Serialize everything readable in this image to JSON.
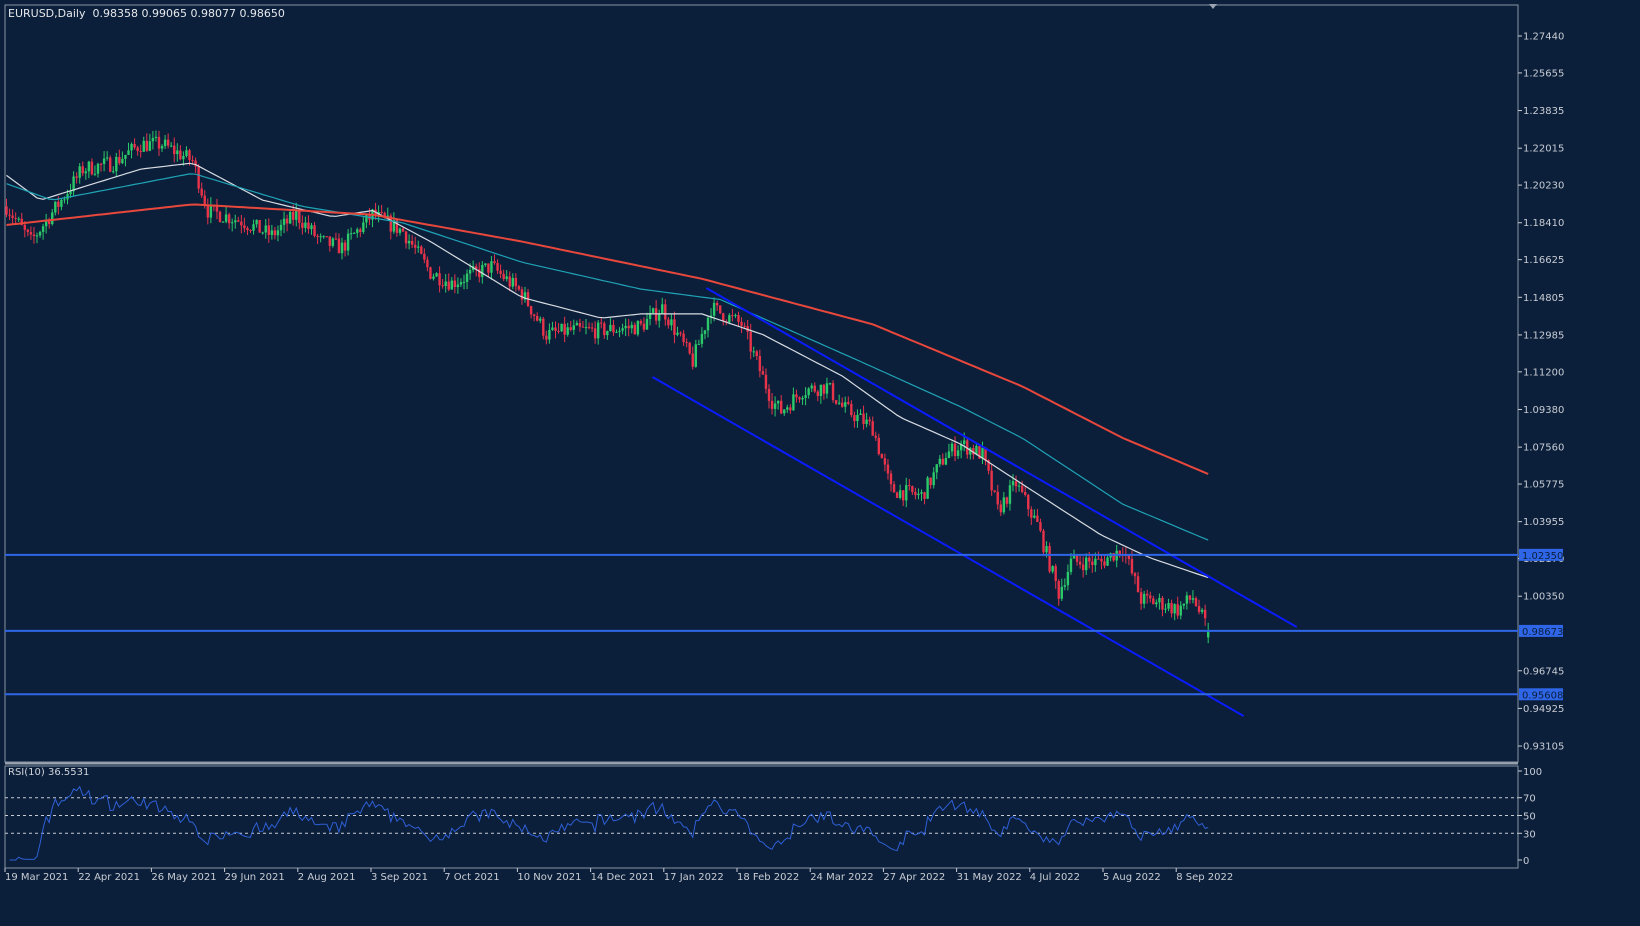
{
  "header": {
    "symbol": "EURUSD,Daily",
    "ohlc": "0.98358 0.99065 0.98077 0.98650"
  },
  "rsi_header": {
    "label": "RSI(10)",
    "value": "36.5531"
  },
  "chart_data": {
    "type": "candlestick",
    "symbol": "EURUSD",
    "timeframe": "Daily",
    "last_bar": {
      "open": 0.98358,
      "high": 0.99065,
      "low": 0.98077,
      "close": 0.9865
    },
    "ylim": [
      0.921,
      1.2885
    ],
    "y_ticks": [
      "1.27440",
      "1.25655",
      "1.23835",
      "1.22015",
      "1.20230",
      "1.18410",
      "1.16625",
      "1.14805",
      "1.12985",
      "1.11200",
      "1.09380",
      "1.07560",
      "1.05775",
      "1.03955",
      "1.02170",
      "1.00350",
      "0.96745",
      "0.94925",
      "0.93105"
    ],
    "x_ticks": [
      "19 Mar 2021",
      "22 Apr 2021",
      "26 May 2021",
      "29 Jun 2021",
      "2 Aug 2021",
      "3 Sep 2021",
      "7 Oct 2021",
      "10 Nov 2021",
      "14 Dec 2021",
      "17 Jan 2022",
      "18 Feb 2022",
      "24 Mar 2022",
      "27 Apr 2022",
      "31 May 2022",
      "4 Jul 2022",
      "5 Aug 2022",
      "8 Sep 2022"
    ],
    "bars_per_tick": 24,
    "bar_count": 395,
    "close_path": [
      [
        0,
        1.192
      ],
      [
        8,
        1.175
      ],
      [
        18,
        1.195
      ],
      [
        25,
        1.21
      ],
      [
        35,
        1.213
      ],
      [
        44,
        1.222
      ],
      [
        51,
        1.222
      ],
      [
        61,
        1.214
      ],
      [
        66,
        1.19
      ],
      [
        77,
        1.185
      ],
      [
        87,
        1.178
      ],
      [
        95,
        1.188
      ],
      [
        103,
        1.175
      ],
      [
        110,
        1.172
      ],
      [
        120,
        1.188
      ],
      [
        130,
        1.18
      ],
      [
        139,
        1.16
      ],
      [
        146,
        1.155
      ],
      [
        159,
        1.163
      ],
      [
        169,
        1.15
      ],
      [
        177,
        1.13
      ],
      [
        185,
        1.132
      ],
      [
        195,
        1.132
      ],
      [
        208,
        1.134
      ],
      [
        215,
        1.143
      ],
      [
        225,
        1.117
      ],
      [
        231,
        1.143
      ],
      [
        241,
        1.135
      ],
      [
        251,
        1.098
      ],
      [
        254,
        1.093
      ],
      [
        261,
        1.103
      ],
      [
        269,
        1.105
      ],
      [
        274,
        1.095
      ],
      [
        284,
        1.085
      ],
      [
        290,
        1.055
      ],
      [
        300,
        1.052
      ],
      [
        308,
        1.072
      ],
      [
        313,
        1.077
      ],
      [
        320,
        1.072
      ],
      [
        325,
        1.045
      ],
      [
        331,
        1.058
      ],
      [
        338,
        1.038
      ],
      [
        345,
        1.005
      ],
      [
        349,
        1.02
      ],
      [
        359,
        1.02
      ],
      [
        366,
        1.027
      ],
      [
        372,
        1.002
      ],
      [
        379,
        1.0
      ],
      [
        384,
        0.997
      ],
      [
        389,
        1.003
      ],
      [
        394,
        0.9865
      ]
    ],
    "moving_averages": [
      {
        "name": "MA50",
        "color": "#d8dce2",
        "points": [
          [
            0,
            1.207
          ],
          [
            11,
            1.195
          ],
          [
            44,
            1.21
          ],
          [
            61,
            1.213
          ],
          [
            84,
            1.195
          ],
          [
            107,
            1.187
          ],
          [
            120,
            1.19
          ],
          [
            139,
            1.175
          ],
          [
            169,
            1.148
          ],
          [
            195,
            1.138
          ],
          [
            208,
            1.14
          ],
          [
            228,
            1.14
          ],
          [
            248,
            1.13
          ],
          [
            274,
            1.11
          ],
          [
            293,
            1.09
          ],
          [
            313,
            1.077
          ],
          [
            339,
            1.052
          ],
          [
            359,
            1.033
          ],
          [
            375,
            1.022
          ],
          [
            395,
            1.012
          ]
        ]
      },
      {
        "name": "MA100",
        "color": "#1fa3b5",
        "points": [
          [
            0,
            1.203
          ],
          [
            15,
            1.195
          ],
          [
            61,
            1.208
          ],
          [
            97,
            1.192
          ],
          [
            130,
            1.184
          ],
          [
            169,
            1.165
          ],
          [
            208,
            1.152
          ],
          [
            234,
            1.147
          ],
          [
            280,
            1.117
          ],
          [
            313,
            1.095
          ],
          [
            333,
            1.08
          ],
          [
            366,
            1.048
          ],
          [
            395,
            1.03
          ]
        ]
      },
      {
        "name": "MA200",
        "color": "#e8473c",
        "points": [
          [
            0,
            1.183
          ],
          [
            61,
            1.193
          ],
          [
            120,
            1.188
          ],
          [
            169,
            1.175
          ],
          [
            228,
            1.157
          ],
          [
            284,
            1.135
          ],
          [
            333,
            1.105
          ],
          [
            366,
            1.08
          ],
          [
            395,
            1.062
          ]
        ]
      }
    ],
    "trendlines": [
      {
        "name": "channel-upper",
        "from": [
          229.5,
          1.1525
        ],
        "to": [
          423,
          0.9886
        ]
      },
      {
        "name": "channel-lower",
        "from": [
          211.8,
          1.1095
        ],
        "to": [
          405.6,
          0.9456
        ]
      }
    ],
    "horizontal_levels": [
      {
        "price": 1.0235,
        "label": "1.02350"
      },
      {
        "price": 0.98673,
        "label": "0.98673"
      },
      {
        "price": 0.95608,
        "label": "0.95608"
      }
    ],
    "rsi": {
      "period": 10,
      "value": 36.5531,
      "levels": [
        70,
        50,
        30
      ],
      "y_ticks": [
        "100",
        "70",
        "50",
        "30",
        "0"
      ],
      "ylim": [
        0,
        100
      ]
    },
    "colors": {
      "background": "#0b1f3a",
      "bull": "#2bc96a",
      "bear": "#e8334a",
      "level": "#2f66e8",
      "trend": "#0a1cff",
      "rsi": "#2f5fd6"
    }
  }
}
